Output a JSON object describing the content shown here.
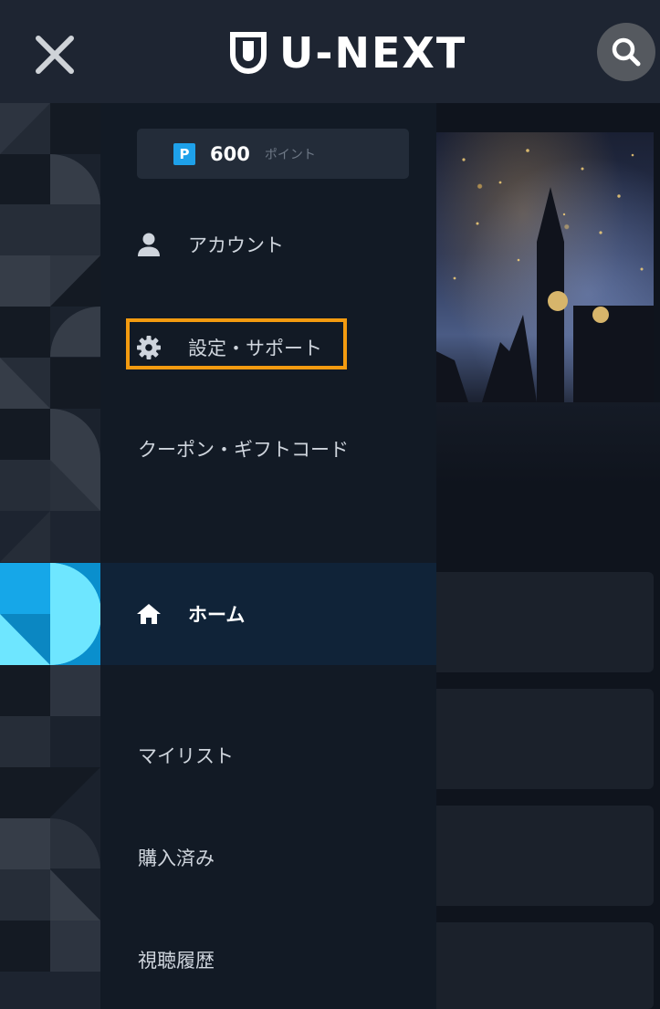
{
  "header": {
    "logo_text": "U-NEXT",
    "close_icon": "close-icon",
    "search_icon": "search-icon"
  },
  "drawer": {
    "points": {
      "badge": "P",
      "value": "600",
      "unit": "ポイント"
    },
    "items": [
      {
        "label": "アカウント",
        "icon": "person-icon"
      },
      {
        "label": "設定・サポート",
        "icon": "gear-icon",
        "highlighted": true
      },
      {
        "label": "クーポン・ギフトコード",
        "icon": ""
      },
      {
        "label": "ホーム",
        "icon": "home-icon",
        "active": true
      },
      {
        "label": "マイリスト",
        "icon": ""
      },
      {
        "label": "購入済み",
        "icon": ""
      },
      {
        "label": "視聴履歴",
        "icon": ""
      }
    ]
  },
  "colors": {
    "header_bg": "#1e2532",
    "drawer_bg": "#121a25",
    "active_row_bg": "#102338",
    "highlight_border": "#f39b10",
    "points_badge": "#1ea1ea"
  }
}
